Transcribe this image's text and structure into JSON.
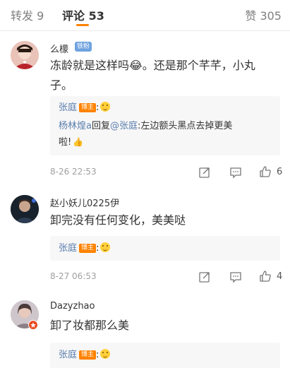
{
  "tabs": {
    "repost": "转发 9",
    "comment": "评论 53",
    "like": "赞 305"
  },
  "comments": [
    {
      "username": "么檬",
      "badge": "铁粉",
      "text_line1": "冻龄就是这样吗😂。还是那个芊芊，小丸",
      "text_line2": "子。",
      "reply_author": "张庭",
      "host_badge": "博主",
      "reply_suffix": ":",
      "reply2_user": "杨林煌a",
      "reply2_mid": "回复",
      "reply2_mention": "@张庭",
      "reply2_text": ":左边额头黑点去掉更美",
      "reply2_text2": "啦!",
      "time": "8-26 22:53",
      "likes": "6"
    },
    {
      "username": "赵小妖儿0225伊",
      "text": "卸完没有任何变化，美美哒",
      "reply_author": "张庭",
      "host_badge": "博主",
      "reply_suffix": ":",
      "time": "8-27 06:53",
      "likes": "4"
    },
    {
      "username": "Dazyzhao",
      "text": "卸了妆都那么美",
      "reply_author": "张庭",
      "host_badge": "博主",
      "reply_suffix": ":"
    }
  ],
  "colors": {
    "accent": "#ff8200",
    "link": "#5b7faf",
    "meta": "#a0a0a0"
  }
}
